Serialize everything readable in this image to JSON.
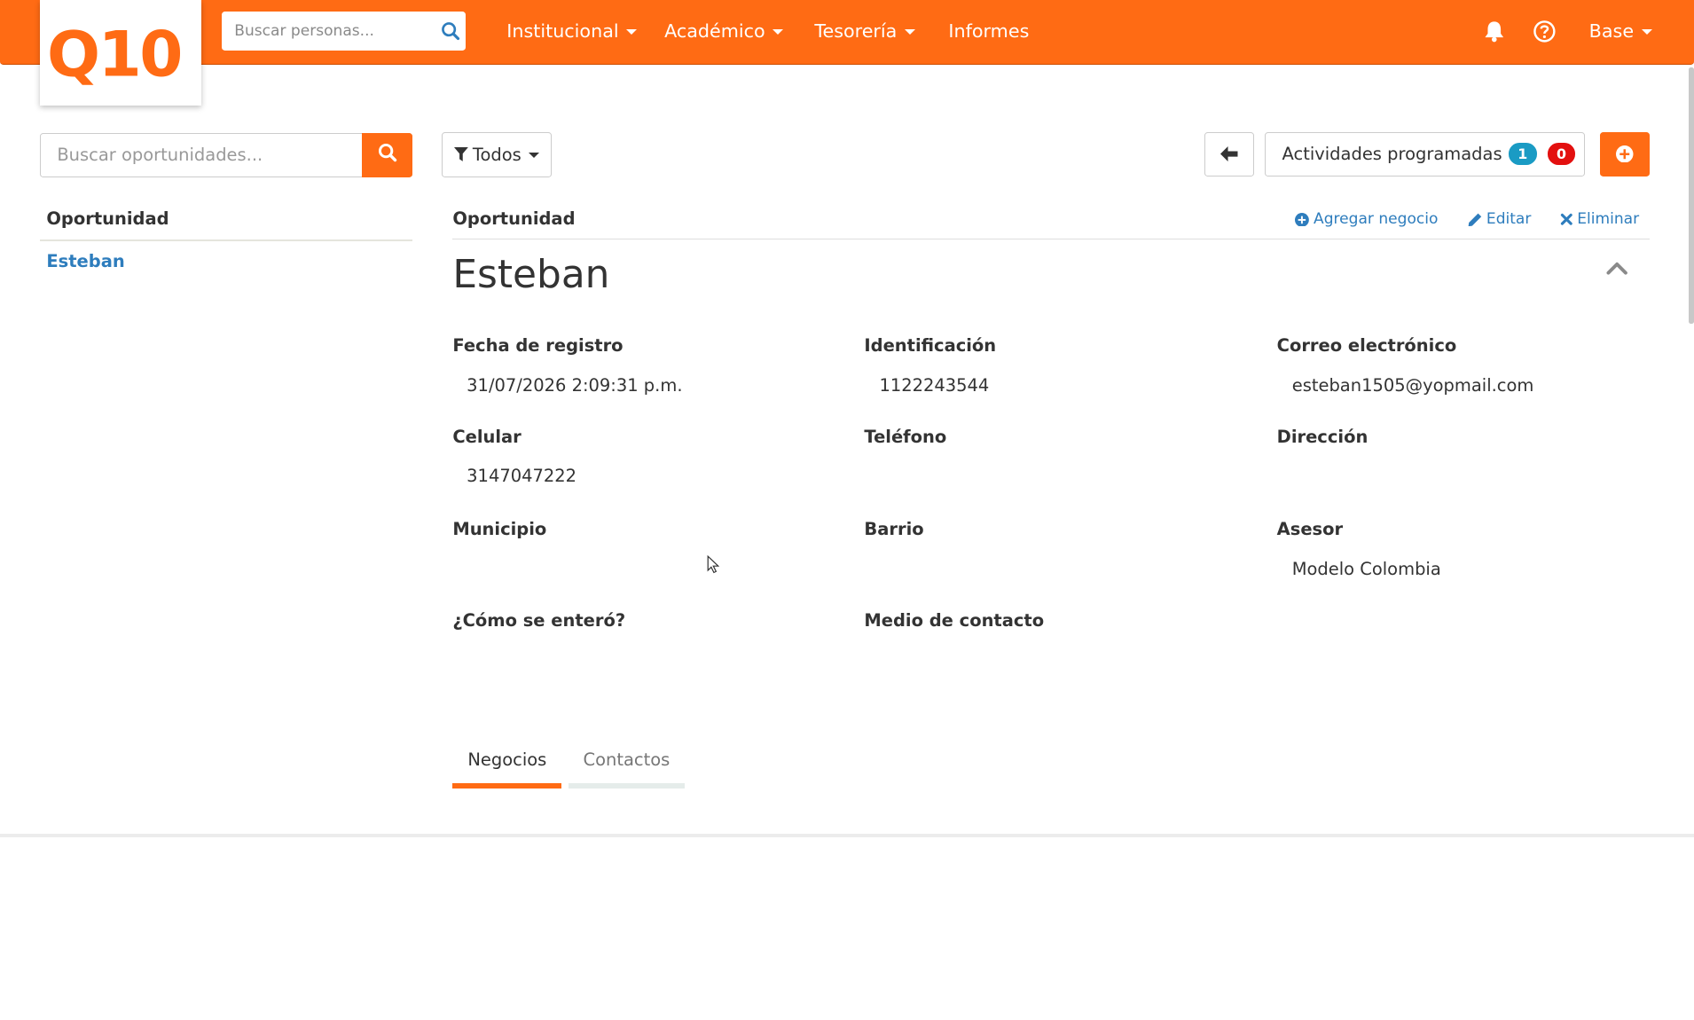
{
  "app": {
    "logo_text": "Q10",
    "colors": {
      "brand": "#ff6b14",
      "link": "#2e7dbd",
      "badge_info": "#1a9bc4",
      "badge_danger": "#e3100f"
    }
  },
  "topbar": {
    "search_placeholder": "Buscar personas...",
    "nav": [
      {
        "label": "Institucional"
      },
      {
        "label": "Académico"
      },
      {
        "label": "Tesorería"
      },
      {
        "label": "Informes"
      }
    ],
    "user_menu": "Base"
  },
  "sidebar": {
    "search_placeholder": "Buscar oportunidades...",
    "header": "Oportunidad",
    "items": [
      {
        "label": "Esteban"
      }
    ]
  },
  "toolbar": {
    "filter_label": "Todos",
    "activities_label": "Actividades programadas",
    "activities_count_info": "1",
    "activities_count_danger": "0"
  },
  "detail": {
    "header": "Oportunidad",
    "actions": {
      "add_business": "Agregar negocio",
      "edit": "Editar",
      "delete": "Eliminar"
    },
    "name": "Esteban",
    "fields": {
      "registration_date": {
        "label": "Fecha de registro",
        "value": "31/07/2026 2:09:31 p.m."
      },
      "identification": {
        "label": "Identificación",
        "value": "1122243544"
      },
      "email": {
        "label": "Correo electrónico",
        "value": "esteban1505@yopmail.com"
      },
      "mobile": {
        "label": "Celular",
        "value": "3147047222"
      },
      "phone": {
        "label": "Teléfono",
        "value": ""
      },
      "address": {
        "label": "Dirección",
        "value": ""
      },
      "municipality": {
        "label": "Municipio",
        "value": ""
      },
      "neighborhood": {
        "label": "Barrio",
        "value": ""
      },
      "advisor": {
        "label": "Asesor",
        "value": "Modelo Colombia"
      },
      "how_found": {
        "label": "¿Cómo se enteró?",
        "value": ""
      },
      "contact_medium": {
        "label": "Medio de contacto",
        "value": ""
      }
    },
    "tabs": [
      {
        "label": "Negocios",
        "active": true
      },
      {
        "label": "Contactos",
        "active": false
      }
    ]
  }
}
